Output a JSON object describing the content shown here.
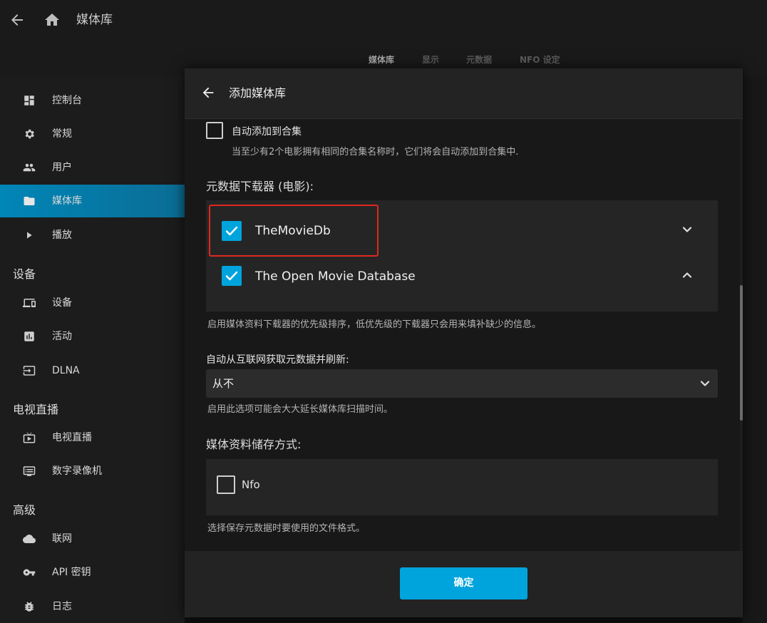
{
  "header": {
    "title": "媒体库"
  },
  "tabs": [
    {
      "label": "媒体库",
      "active": true
    },
    {
      "label": "显示",
      "active": false
    },
    {
      "label": "元数据",
      "active": false
    },
    {
      "label": "NFO 设定",
      "active": false
    }
  ],
  "sidebar": {
    "items": [
      {
        "label": "控制台",
        "icon": "dashboard-icon"
      },
      {
        "label": "常规",
        "icon": "gear-icon"
      },
      {
        "label": "用户",
        "icon": "people-icon"
      },
      {
        "label": "媒体库",
        "icon": "folder-icon",
        "active": true
      },
      {
        "label": "播放",
        "icon": "play-icon"
      },
      {
        "label": "设备",
        "icon": "devices-icon"
      },
      {
        "label": "活动",
        "icon": "activity-icon"
      },
      {
        "label": "DLNA",
        "icon": "input-icon"
      },
      {
        "label": "电视直播",
        "icon": "live-tv-icon"
      },
      {
        "label": "数字录像机",
        "icon": "dvr-icon"
      },
      {
        "label": "联网",
        "icon": "cloud-icon"
      },
      {
        "label": "API 密钥",
        "icon": "key-icon"
      },
      {
        "label": "日志",
        "icon": "bug-icon"
      }
    ],
    "sections": [
      "设备",
      "电视直播",
      "高级"
    ]
  },
  "dialog": {
    "title": "添加媒体库",
    "auto_collection": {
      "label": "自动添加到合集",
      "description": "当至少有2个电影拥有相同的合集名称时，它们将会自动添加到合集中.",
      "checked": false
    },
    "metadata_downloaders": {
      "title": "元数据下载器 (电影):",
      "items": [
        {
          "label": "TheMovieDb",
          "checked": true,
          "chevron": "chevron-down-icon"
        },
        {
          "label": "The Open Movie Database",
          "checked": true,
          "chevron": "chevron-up-icon"
        }
      ],
      "description": "启用媒体资料下载器的优先级排序，低优先级的下载器只会用来填补缺少的信息。"
    },
    "refresh": {
      "label": "自动从互联网获取元数据并刷新:",
      "value": "从不",
      "description": "启用此选项可能会大大延长媒体库扫描时间。"
    },
    "savers": {
      "title": "媒体资料储存方式:",
      "items": [
        {
          "label": "Nfo",
          "checked": false
        }
      ],
      "description": "选择保存元数据时要使用的文件格式。"
    },
    "ok_label": "确定"
  },
  "colors": {
    "accent": "#00a4dc",
    "highlight_border": "#e0281f",
    "background": "#101010"
  }
}
